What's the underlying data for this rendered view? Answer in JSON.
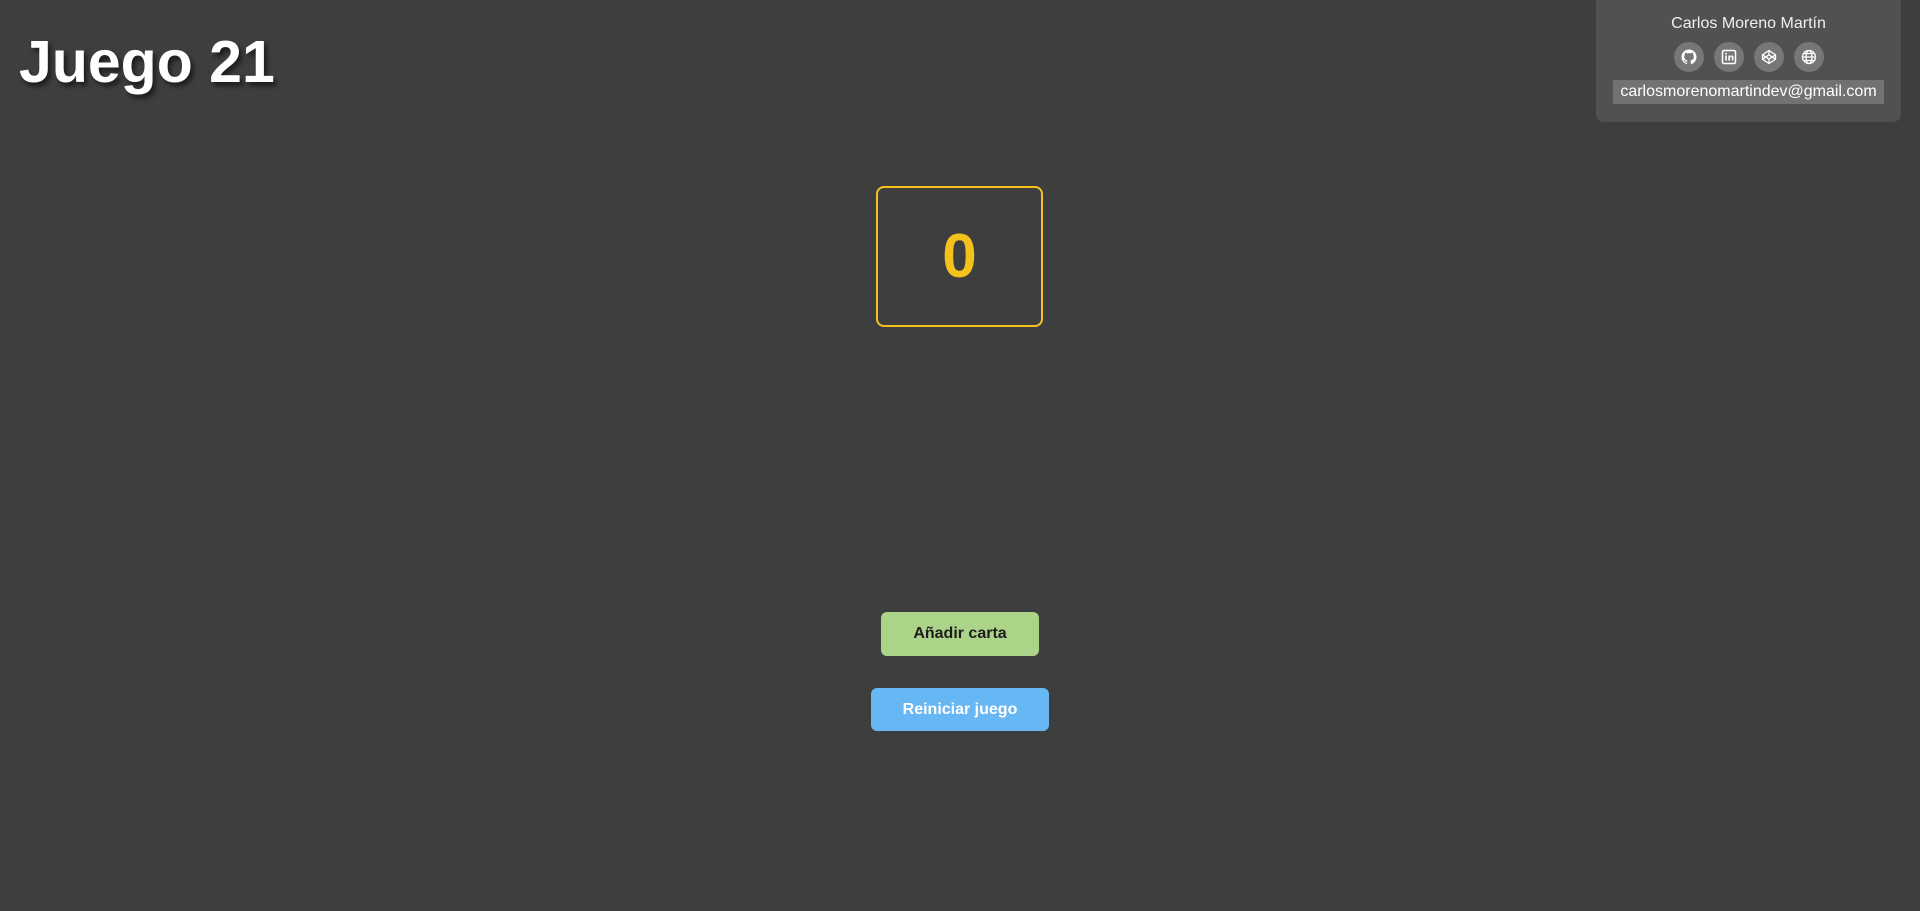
{
  "header": {
    "title": "Juego 21"
  },
  "profile": {
    "name": "Carlos Moreno Martín",
    "links": [
      {
        "icon": "github-icon"
      },
      {
        "icon": "linkedin-icon"
      },
      {
        "icon": "codepen-icon"
      },
      {
        "icon": "globe-icon"
      }
    ],
    "email": "carlosmorenomartindev@gmail.com"
  },
  "game": {
    "score": "0"
  },
  "actions": {
    "add_card_label": "Añadir carta",
    "reset_label": "Reiniciar juego"
  },
  "colors": {
    "background": "#3e3e3e",
    "score_accent": "#f5c21b",
    "add_button": "#acd488",
    "reset_button": "#66b7f4"
  }
}
